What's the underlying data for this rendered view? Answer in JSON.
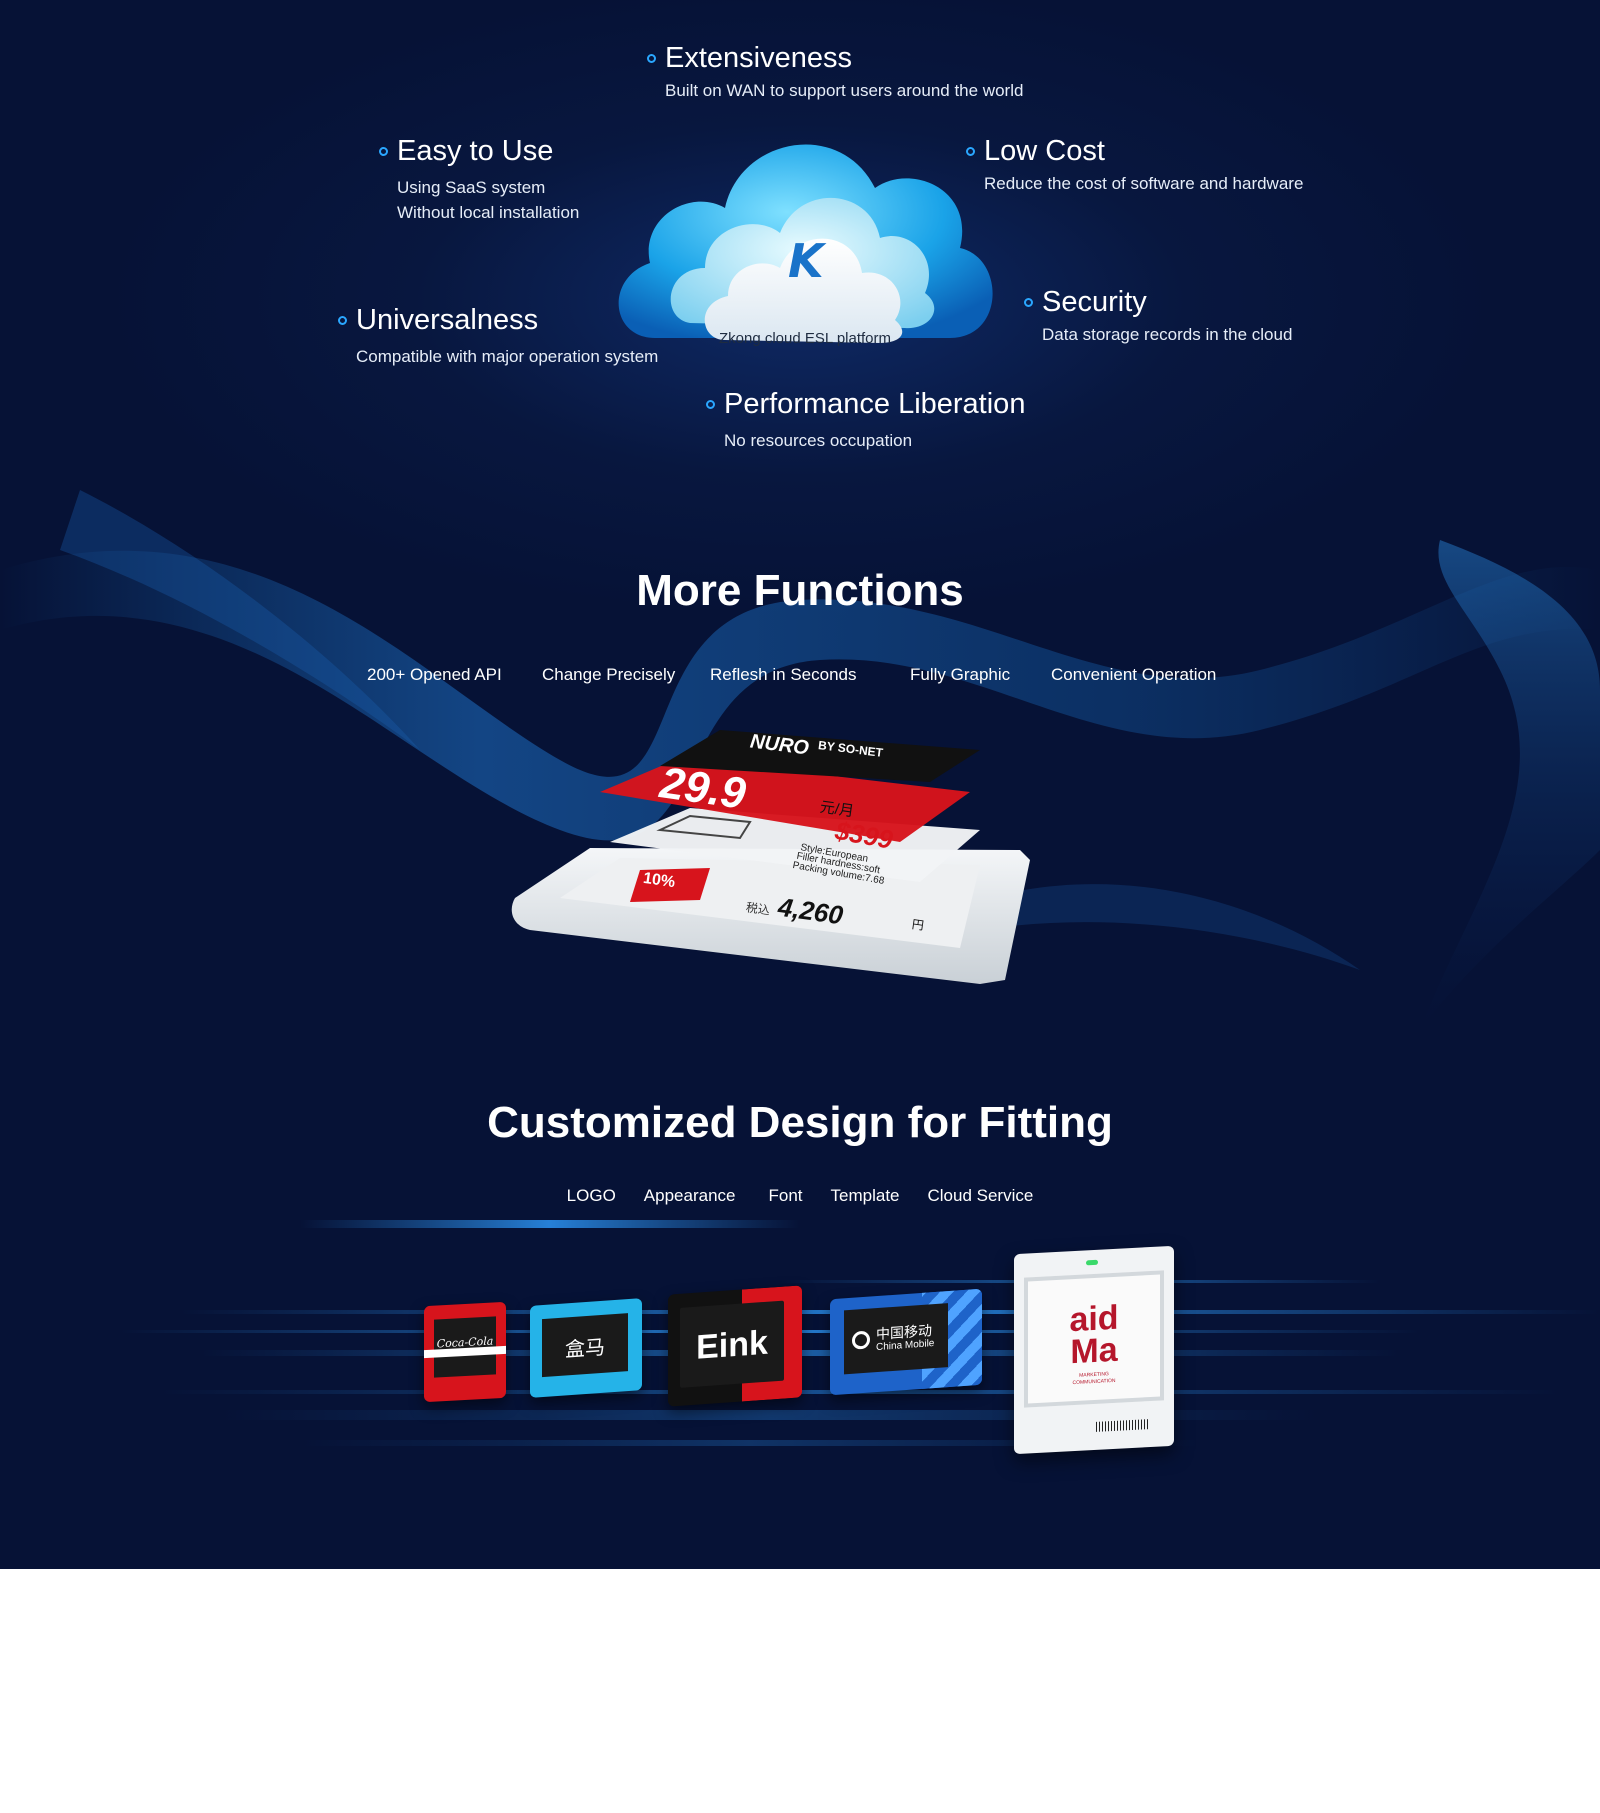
{
  "cloud": {
    "platform_label": "Zkong cloud ESL platform",
    "logo_letter": "K",
    "features": [
      {
        "id": "extensiveness",
        "title": "Extensiveness",
        "desc": [
          "Built on WAN to support users around the world"
        ]
      },
      {
        "id": "easy",
        "title": "Easy to Use",
        "desc": [
          "Using SaaS system",
          "Without local installation"
        ]
      },
      {
        "id": "lowcost",
        "title": "Low Cost",
        "desc": [
          "Reduce the cost of software and hardware"
        ]
      },
      {
        "id": "universal",
        "title": "Universalness",
        "desc": [
          "Compatible with major operation system"
        ]
      },
      {
        "id": "security",
        "title": "Security",
        "desc": [
          "Data storage records in the cloud"
        ]
      },
      {
        "id": "performance",
        "title": "Performance Liberation",
        "desc": [
          "No resources occupation"
        ]
      }
    ]
  },
  "more_functions": {
    "title": "More Functions",
    "items": [
      "200+ Opened API",
      "Change Precisely",
      "Reflesh in Seconds",
      "Fully Graphic",
      "Convenient Operation"
    ]
  },
  "esl_labels": {
    "brand": "NURO",
    "brand_sub": "BY SO-NET",
    "price_big": "29.9",
    "price_unit": "元/月",
    "price_usd": "$399",
    "spec_1": "Style:European",
    "spec_2": "Filler hardness:soft",
    "spec_3": "Packing volume:7.68",
    "price_jp": "4,260",
    "yen": "円",
    "tax_label": "税込",
    "discount": "10%"
  },
  "customized": {
    "title": "Customized Design for Fitting",
    "items": [
      "LOGO",
      "Appearance",
      "Font",
      "Template",
      "Cloud Service"
    ]
  },
  "devices": {
    "coke": "Coca-Cola",
    "hema": "盒马",
    "eink": "Eink",
    "cm_cn": "中国移动",
    "cm_en": "China Mobile",
    "aid_1": "aid",
    "aid_2": "Ma",
    "aid_sub": "MARKETING COMMUNICATION"
  },
  "colors": {
    "background": "#08173f",
    "accent": "#2aa7ff",
    "red": "#d7141c",
    "blue_device": "#1e63c9",
    "cyan_device": "#25b3e8"
  }
}
